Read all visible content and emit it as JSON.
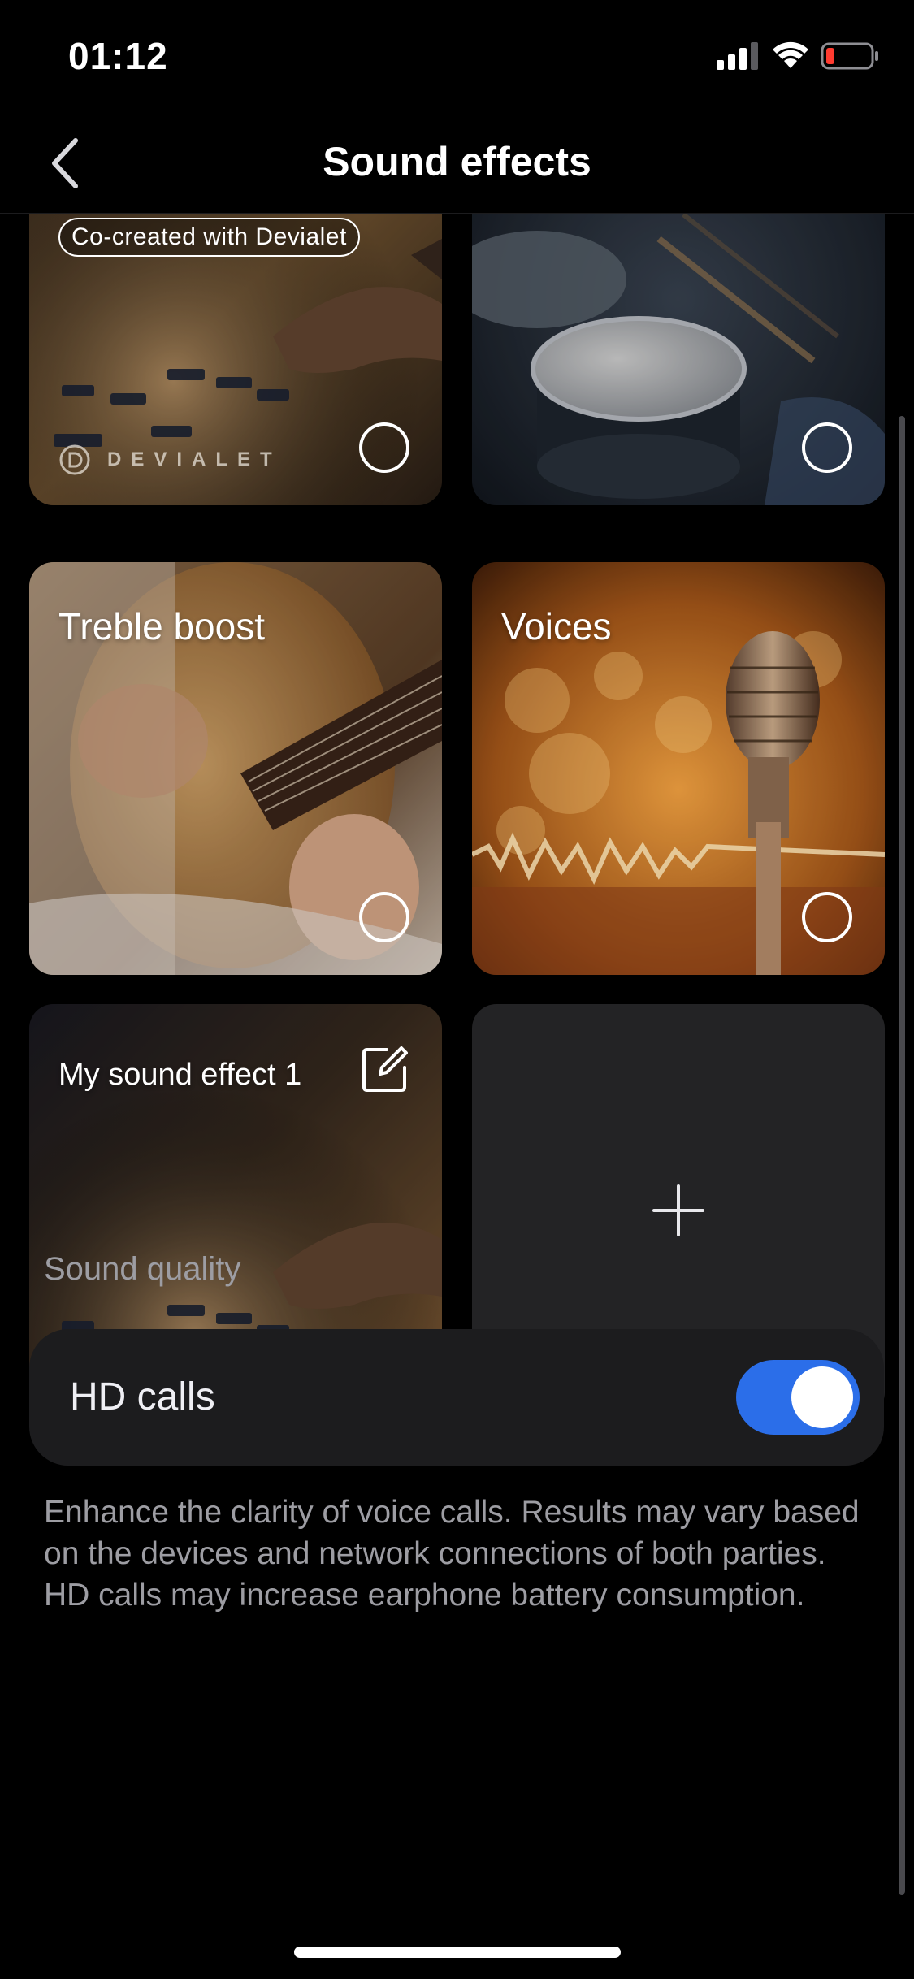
{
  "status_bar": {
    "time": "01:12"
  },
  "header": {
    "title": "Sound effects"
  },
  "cards": {
    "devialet": {
      "badge": "Co-created with Devialet",
      "logo_text": "DEVIALET",
      "selected": false
    },
    "drums": {
      "selected": false
    },
    "treble": {
      "title": "Treble boost",
      "selected": false
    },
    "voices": {
      "title": "Voices",
      "selected": false
    },
    "custom": {
      "title": "My sound effect 1",
      "selected": true
    }
  },
  "sound_quality": {
    "section_label": "Sound quality",
    "hd_calls": {
      "label": "HD calls",
      "enabled": true
    },
    "description": "Enhance the clarity of voice calls. Results may vary based on the devices and network connections of both parties. HD calls may increase earphone battery consumption."
  },
  "colors": {
    "accent": "#2b6ee9",
    "card_bg": "#1c1c1e"
  }
}
